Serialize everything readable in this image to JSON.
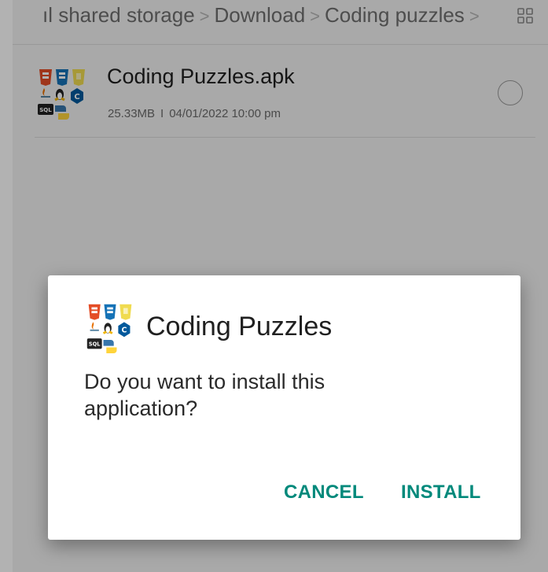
{
  "breadcrumb": {
    "items": [
      "ıl shared storage",
      "Download",
      "Coding puzzles"
    ],
    "separator": ">"
  },
  "file": {
    "name": "Coding Puzzles.apk",
    "size": "25.33MB",
    "date": "04/01/2022 10:00 pm",
    "meta_separator": "I",
    "selected": false
  },
  "dialog": {
    "app_name": "Coding Puzzles",
    "message": "Do you want to install this application?",
    "cancel_label": "CANCEL",
    "install_label": "INSTALL"
  },
  "colors": {
    "accent": "#00897b",
    "html5": "#e44d26",
    "css3": "#1572b6",
    "js": "#f0db4f",
    "c": "#00599c",
    "python_blue": "#3776ab",
    "python_yellow": "#ffd43b"
  },
  "icons": [
    "grid-view-icon",
    "app-icon",
    "radio-unchecked-icon"
  ]
}
